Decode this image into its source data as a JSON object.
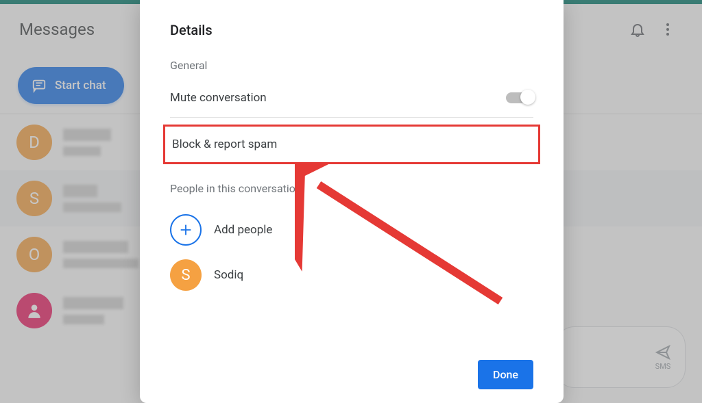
{
  "header": {
    "title": "Messages"
  },
  "start_chat": {
    "label": "Start chat"
  },
  "conversations": [
    {
      "initial": "D",
      "color": "orange"
    },
    {
      "initial": "S",
      "color": "orange"
    },
    {
      "initial": "O",
      "color": "orange"
    },
    {
      "initial": "",
      "color": "pink",
      "icon": "person"
    }
  ],
  "compose": {
    "send_label": "SMS"
  },
  "modal": {
    "title": "Details",
    "general_label": "General",
    "mute_label": "Mute conversation",
    "mute_on": false,
    "block_label": "Block & report spam",
    "people_label": "People in this conversation",
    "add_people_label": "Add people",
    "participant": {
      "name": "Sodiq",
      "initial": "S"
    },
    "done_label": "Done"
  },
  "annotation": {
    "highlight_target": "block-report-spam"
  }
}
